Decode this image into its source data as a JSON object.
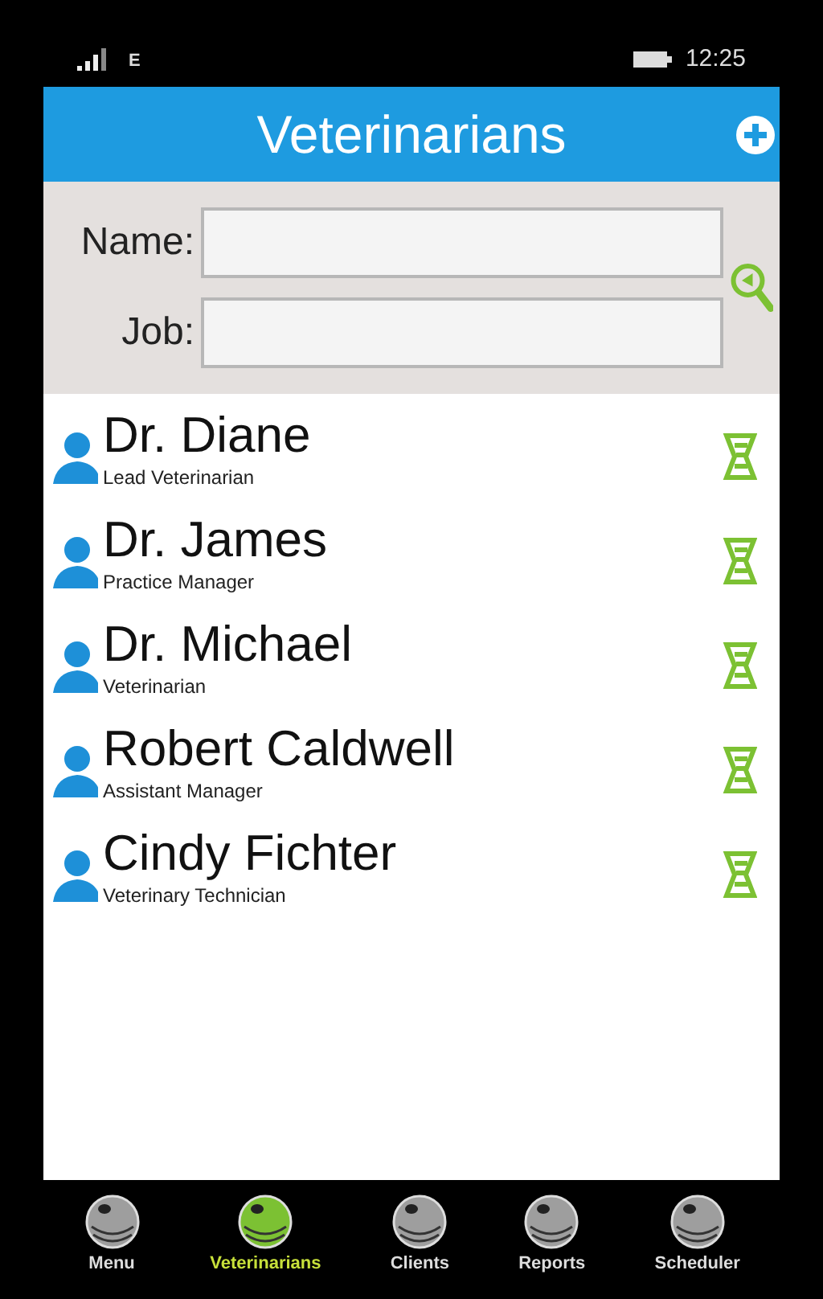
{
  "status_bar": {
    "network": "E",
    "time": "12:25"
  },
  "header": {
    "title": "Veterinarians"
  },
  "search": {
    "fields": [
      {
        "label": "Name:"
      },
      {
        "label": "Job:"
      }
    ]
  },
  "vets": [
    {
      "name": "Dr. Diane",
      "job": "Lead Veterinarian"
    },
    {
      "name": "Dr. James",
      "job": "Practice Manager"
    },
    {
      "name": "Dr. Michael",
      "job": "Veterinarian"
    },
    {
      "name": "Robert Caldwell",
      "job": "Assistant Manager"
    },
    {
      "name": "Cindy Fichter",
      "job": "Veterinary Technician"
    }
  ],
  "nav": [
    {
      "label": "Menu",
      "selected": false
    },
    {
      "label": "Veterinarians",
      "selected": true
    },
    {
      "label": "Clients",
      "selected": false
    },
    {
      "label": "Reports",
      "selected": false
    },
    {
      "label": "Scheduler",
      "selected": false
    }
  ]
}
